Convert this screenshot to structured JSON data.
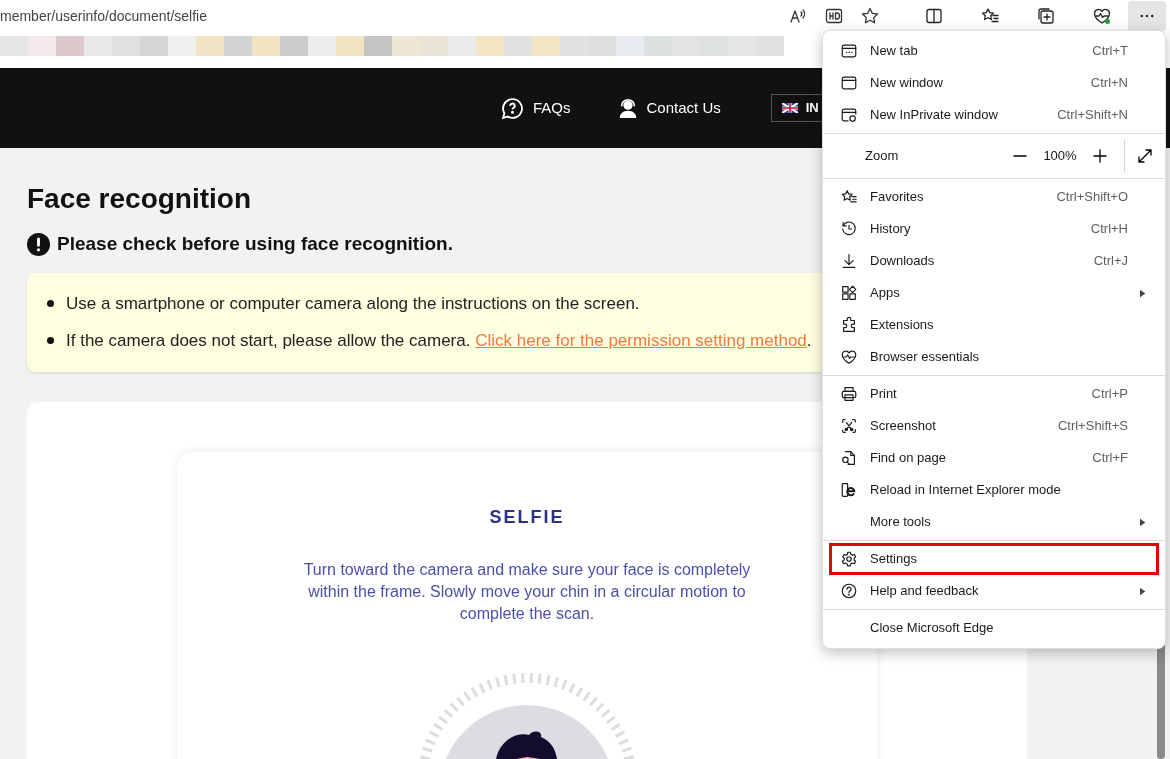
{
  "address_bar": {
    "url": "member/userinfo/document/selfie"
  },
  "header": {
    "links": [
      {
        "label": "FAQs"
      },
      {
        "label": "Contact Us"
      }
    ],
    "language": "IN"
  },
  "page": {
    "title": "Face recognition",
    "notice_heading": "Please check before using face recognition.",
    "notices": [
      {
        "text": "Use a smartphone or computer camera along the instructions on the screen."
      },
      {
        "text": "If the camera does not start, please allow the camera.",
        "link": "Click here for the permission setting method",
        "after": "."
      }
    ],
    "selfie": {
      "title": "SELFIE",
      "instructions": "Turn toward the camera and make sure your face is completely within the frame. Slowly move your chin in a circular motion to complete the scan."
    }
  },
  "menu": {
    "groups": [
      [
        {
          "kind": "item",
          "label": "New tab",
          "shortcut": "Ctrl+T",
          "submenu": false,
          "highlighted": false
        },
        {
          "kind": "item",
          "label": "New window",
          "shortcut": "Ctrl+N",
          "submenu": false,
          "highlighted": false
        },
        {
          "kind": "item",
          "label": "New InPrivate window",
          "shortcut": "Ctrl+Shift+N",
          "submenu": false,
          "highlighted": false
        }
      ],
      [
        {
          "kind": "zoom",
          "label": "Zoom",
          "value": "100%"
        }
      ],
      [
        {
          "kind": "item",
          "label": "Favorites",
          "shortcut": "Ctrl+Shift+O",
          "submenu": false,
          "highlighted": false
        },
        {
          "kind": "item",
          "label": "History",
          "shortcut": "Ctrl+H",
          "submenu": false,
          "highlighted": false
        },
        {
          "kind": "item",
          "label": "Downloads",
          "shortcut": "Ctrl+J",
          "submenu": false,
          "highlighted": false
        },
        {
          "kind": "item",
          "label": "Apps",
          "submenu": true,
          "highlighted": false
        },
        {
          "kind": "item",
          "label": "Extensions",
          "submenu": false,
          "highlighted": false
        },
        {
          "kind": "item",
          "label": "Browser essentials",
          "submenu": false,
          "highlighted": false
        }
      ],
      [
        {
          "kind": "item",
          "label": "Print",
          "shortcut": "Ctrl+P",
          "submenu": false,
          "highlighted": false
        },
        {
          "kind": "item",
          "label": "Screenshot",
          "shortcut": "Ctrl+Shift+S",
          "submenu": false,
          "highlighted": false
        },
        {
          "kind": "item",
          "label": "Find on page",
          "shortcut": "Ctrl+F",
          "submenu": false,
          "highlighted": false
        },
        {
          "kind": "item",
          "label": "Reload in Internet Explorer mode",
          "submenu": false,
          "highlighted": false
        },
        {
          "kind": "item",
          "label": "More tools",
          "submenu": true,
          "highlighted": false
        }
      ],
      [
        {
          "kind": "item",
          "label": "Settings",
          "submenu": false,
          "highlighted": true
        },
        {
          "kind": "item",
          "label": "Help and feedback",
          "submenu": true,
          "highlighted": false
        }
      ],
      [
        {
          "kind": "item",
          "label": "Close Microsoft Edge",
          "submenu": false,
          "highlighted": false
        }
      ]
    ]
  }
}
